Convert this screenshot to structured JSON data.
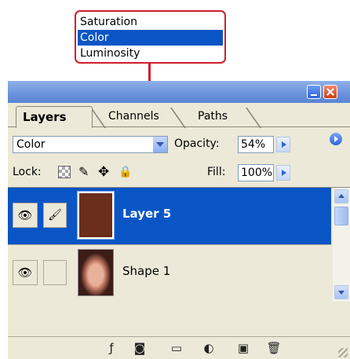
{
  "callout": {
    "options": [
      "Saturation",
      "Color",
      "Luminosity"
    ],
    "selected_index": 1
  },
  "panel": {
    "tabs": [
      "Layers",
      "Channels",
      "Paths"
    ],
    "active_tab": "Layers",
    "blend_mode": "Color",
    "opacity_label": "Opacity:",
    "opacity_value": "54%",
    "lock_label": "Lock:",
    "fill_label": "Fill:",
    "fill_value": "100%",
    "layers": [
      {
        "name": "Layer 5",
        "selected": true
      },
      {
        "name": "Shape 1",
        "selected": false
      }
    ],
    "bottom_icons": [
      "layer-style-icon",
      "mask-icon",
      "new-group-icon",
      "adjustment-layer-icon",
      "new-layer-icon",
      "trash-icon"
    ]
  },
  "colors": {
    "accent_red": "#d01f2b",
    "selection_blue": "#0a55c6",
    "panel_bg": "#ece9d8"
  }
}
